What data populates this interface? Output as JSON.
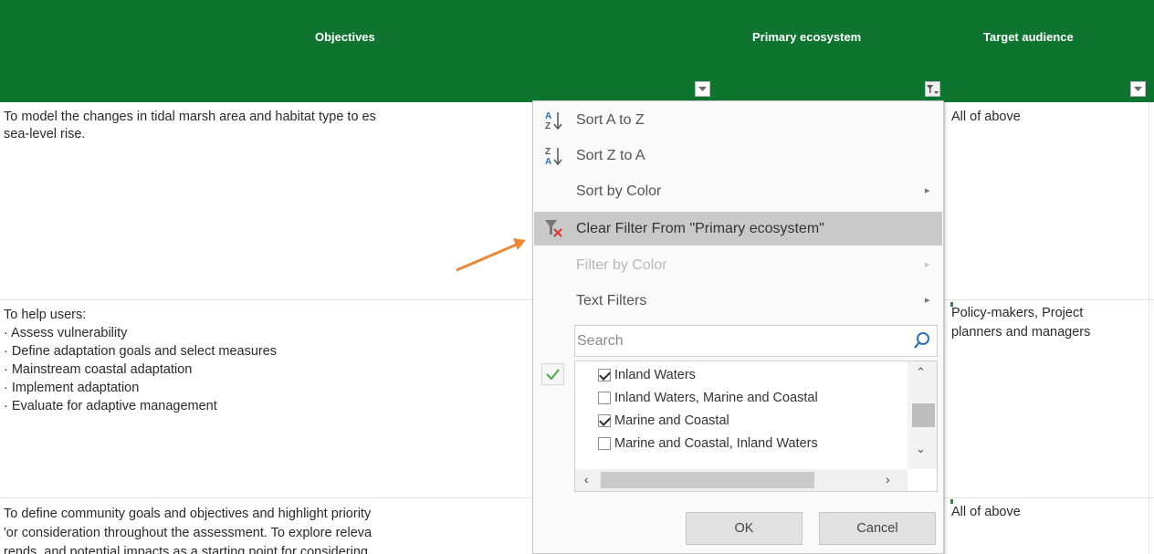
{
  "sheet": {
    "headers": {
      "objectives": "Objectives",
      "primary_ecosystem": "Primary ecosystem",
      "target_audience": "Target audience"
    },
    "rows": [
      {
        "objectives": "To model the changes in tidal marsh area and habitat type to es\nsea-level rise.",
        "audience": "All of above"
      },
      {
        "objectives": "To help users:\n· Assess vulnerability\n· Define adaptation goals and select measures\n· Mainstream coastal adaptation\n· Implement adaptation\n· Evaluate for adaptive management",
        "audience": "Policy-makers, Project\nplanners and managers"
      },
      {
        "objectives": "To define community goals and objectives and highlight priority\n'or consideration throughout the assessment. To explore releva\nrends, and potential impacts as a starting point for considering",
        "audience": "All of above"
      }
    ]
  },
  "filter_menu": {
    "sort_a_to_z": "Sort A to Z",
    "sort_z_to_a": "Sort Z to A",
    "sort_by_color": "Sort by Color",
    "clear_filter": "Clear Filter From \"Primary ecosystem\"",
    "filter_by_color": "Filter by Color",
    "text_filters": "Text Filters",
    "search_placeholder": "Search",
    "values": [
      {
        "label": "Inland Waters",
        "checked": true
      },
      {
        "label": "Inland Waters, Marine and Coastal",
        "checked": false
      },
      {
        "label": "Marine and Coastal",
        "checked": true
      },
      {
        "label": "Marine and Coastal, Inland Waters",
        "checked": false
      }
    ],
    "ok_label": "OK",
    "cancel_label": "Cancel"
  },
  "colors": {
    "header_green": "#0f7430",
    "highlight": "#c9c9c9",
    "arrow": "#e8883a"
  }
}
